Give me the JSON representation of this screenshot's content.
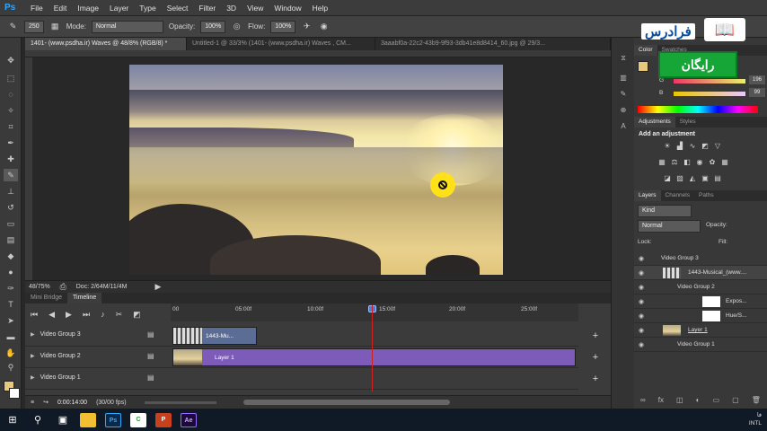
{
  "app": {
    "logo": "Ps",
    "menus": [
      "File",
      "Edit",
      "Image",
      "Layer",
      "Type",
      "Select",
      "Filter",
      "3D",
      "View",
      "Window",
      "Help"
    ]
  },
  "options": {
    "brush_size": "250",
    "mode_label": "Mode:",
    "mode_value": "Normal",
    "opacity_label": "Opacity:",
    "opacity_value": "100%",
    "flow_label": "Flow:",
    "flow_value": "100%"
  },
  "doc_tabs": [
    {
      "label": "1401- (www.psdha.ir) Waves @ 48/8% (RGB/8) *",
      "active": true
    },
    {
      "label": "Untitled-1 @ 33/3% (1401- (www.psdha.ir) Waves , CM...",
      "active": false
    },
    {
      "label": "3aaabf0a-22c2-43b9-9f93-3db41e8d8414_60.jpg @ 29/3...",
      "active": false
    }
  ],
  "status": {
    "zoom": "48/75%",
    "doc": "Doc: 2/64M/11/4M"
  },
  "timeline": {
    "tabs": [
      "Mini Bridge",
      "Timeline"
    ],
    "ticks": [
      "00",
      "05:00f",
      "10:00f",
      "15:00f",
      "20:00f",
      "25:00f"
    ],
    "tracks": [
      {
        "name": "Video Group 3",
        "clip": "1443-Mu..."
      },
      {
        "name": "Video Group 2",
        "clip": "Layer 1"
      },
      {
        "name": "Video Group 1",
        "clip": ""
      }
    ],
    "timecode": "0:00:14:00",
    "fps": "(30/00 fps)"
  },
  "color_panel": {
    "tabs": [
      "Color",
      "Swatches"
    ],
    "fg": "#e8c87a",
    "values": {
      "R": "",
      "G": "196",
      "B": "99"
    }
  },
  "adjustments": {
    "tabs": [
      "Adjustments",
      "Styles"
    ],
    "heading": "Add an adjustment"
  },
  "layers_panel": {
    "tabs": [
      "Layers",
      "Channels",
      "Paths"
    ],
    "filter": "Kind",
    "blend": "Normal",
    "opacity_label": "Opacity:",
    "lock_label": "Lock:",
    "fill_label": "Fill:",
    "layers": [
      {
        "name": "Video Group 3",
        "type": "group"
      },
      {
        "name": "1443-Musical_(www....",
        "type": "video"
      },
      {
        "name": "Video Group 2",
        "type": "group"
      },
      {
        "name": "Expos...",
        "type": "adjustment"
      },
      {
        "name": "Hue/S...",
        "type": "adjustment"
      },
      {
        "name": "Layer 1",
        "type": "image"
      },
      {
        "name": "Video Group 1",
        "type": "group"
      }
    ]
  },
  "promo": {
    "logo_text": "فرادرس",
    "badge": "رایگان"
  },
  "taskbar": {
    "lang": "فا",
    "locale": "INTL"
  }
}
